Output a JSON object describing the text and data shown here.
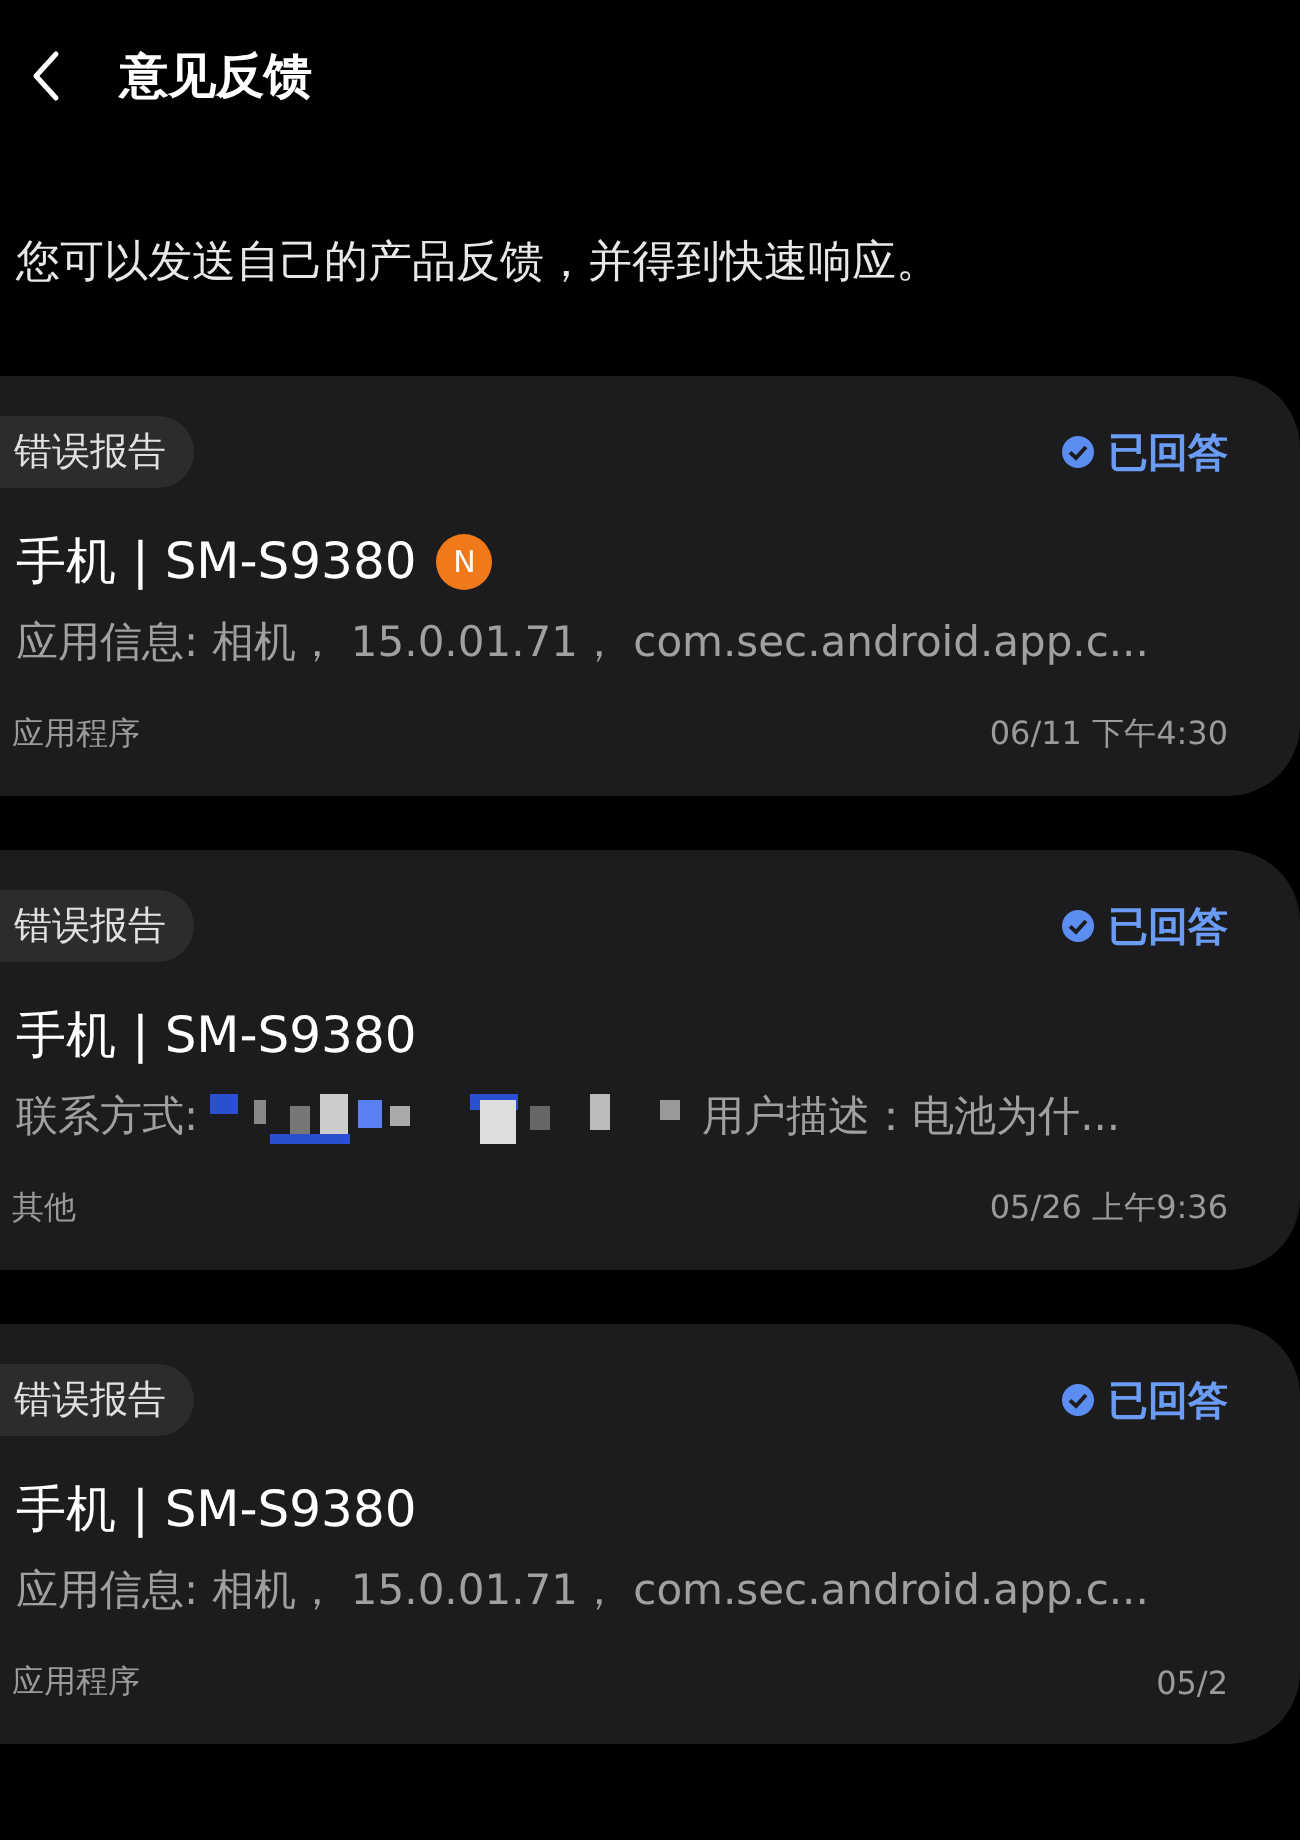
{
  "header": {
    "title": "意见反馈"
  },
  "intro": "您可以发送自己的产品反馈，并得到快速响应。",
  "cards": [
    {
      "tag": "错误报告",
      "status": "已回答",
      "answered": true,
      "title": "手机 | SM-S9380",
      "badge": "N",
      "detail": [
        {
          "kind": "text",
          "text": "应用信息: 相机， 15.0.01.71， com.sec.android.app.c..."
        }
      ],
      "category": "应用程序",
      "time": "06/11 下午4:30"
    },
    {
      "tag": "错误报告",
      "status": "已回答",
      "answered": true,
      "title": "手机 | SM-S9380",
      "detail": [
        {
          "kind": "text",
          "text": "联系方式:"
        },
        {
          "kind": "redacted"
        },
        {
          "kind": "text",
          "text": "用户描述：电池为什..."
        }
      ],
      "category": "其他",
      "time": "05/26 上午9:36"
    },
    {
      "tag": "错误报告",
      "status": "已回答",
      "answered": true,
      "title": "手机 | SM-S9380",
      "detail": [
        {
          "kind": "text",
          "text": "应用信息: 相机， 15.0.01.71， com.sec.android.app.c..."
        }
      ],
      "category": "应用程序",
      "time": "05/2"
    }
  ]
}
